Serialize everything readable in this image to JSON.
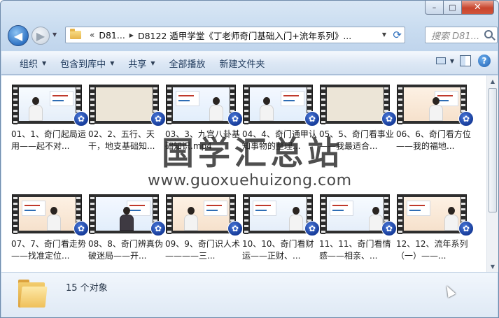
{
  "window": {
    "caption": {
      "minimize": "–",
      "maximize": "□",
      "close": "✕"
    }
  },
  "nav": {
    "back": "◀",
    "forward": "▶",
    "dropdown": "▼",
    "breadcrumb_chevron": "«",
    "breadcrumbs": [
      "D81...",
      "D8122 遁甲学堂《丁老师奇门基础入门+流年系列》..."
    ],
    "refresh": "⟳",
    "search_placeholder": "搜索 D81..."
  },
  "toolbar": {
    "organize": "组织",
    "include_library": "包含到库中",
    "share": "共享",
    "play_all": "全部播放",
    "new_folder": "新建文件夹",
    "help": "?"
  },
  "files": [
    {
      "name": "01、1、奇门起局运用——起不对...",
      "thumb": "slide"
    },
    {
      "name": "02、2、五行、天干，地支基础知...",
      "thumb": "blank"
    },
    {
      "name": "03、3、九宫八卦基础知识.mp4",
      "thumb": "green"
    },
    {
      "name": "04、4、奇门通甲认知事物的整理...",
      "thumb": "green"
    },
    {
      "name": "05、5、奇门看事业——我最适合...",
      "thumb": "blank"
    },
    {
      "name": "06、6、奇门看方位——我的福地...",
      "thumb": "warm"
    },
    {
      "name": "07、7、奇门看走势——找准定位...",
      "thumb": "warm"
    },
    {
      "name": "08、8、奇门辨真伪破迷局——开...",
      "thumb": "green"
    },
    {
      "name": "09、9、奇门识人术————三...",
      "thumb": "warm"
    },
    {
      "name": "10、10、奇门看财运——正财、...",
      "thumb": "slide"
    },
    {
      "name": "11、11、奇门看情感——相亲、...",
      "thumb": "slide"
    },
    {
      "name": "12、12、流年系列（一）——...",
      "thumb": "warm"
    }
  ],
  "watermark": {
    "title": "国学汇总站",
    "url": "www.guoxuehuizong.com"
  },
  "details": {
    "count": "15 个对象"
  },
  "colors": {
    "accent": "#2f73c4",
    "toolbar_text": "#1e395b",
    "play_badge": "#173c9a"
  },
  "icons": [
    "back-arrow-icon",
    "forward-arrow-icon",
    "folder-icon",
    "refresh-icon",
    "search-icon",
    "view-icon",
    "preview-pane-icon",
    "help-icon",
    "play-badge-icon",
    "mouse-cursor-icon"
  ]
}
